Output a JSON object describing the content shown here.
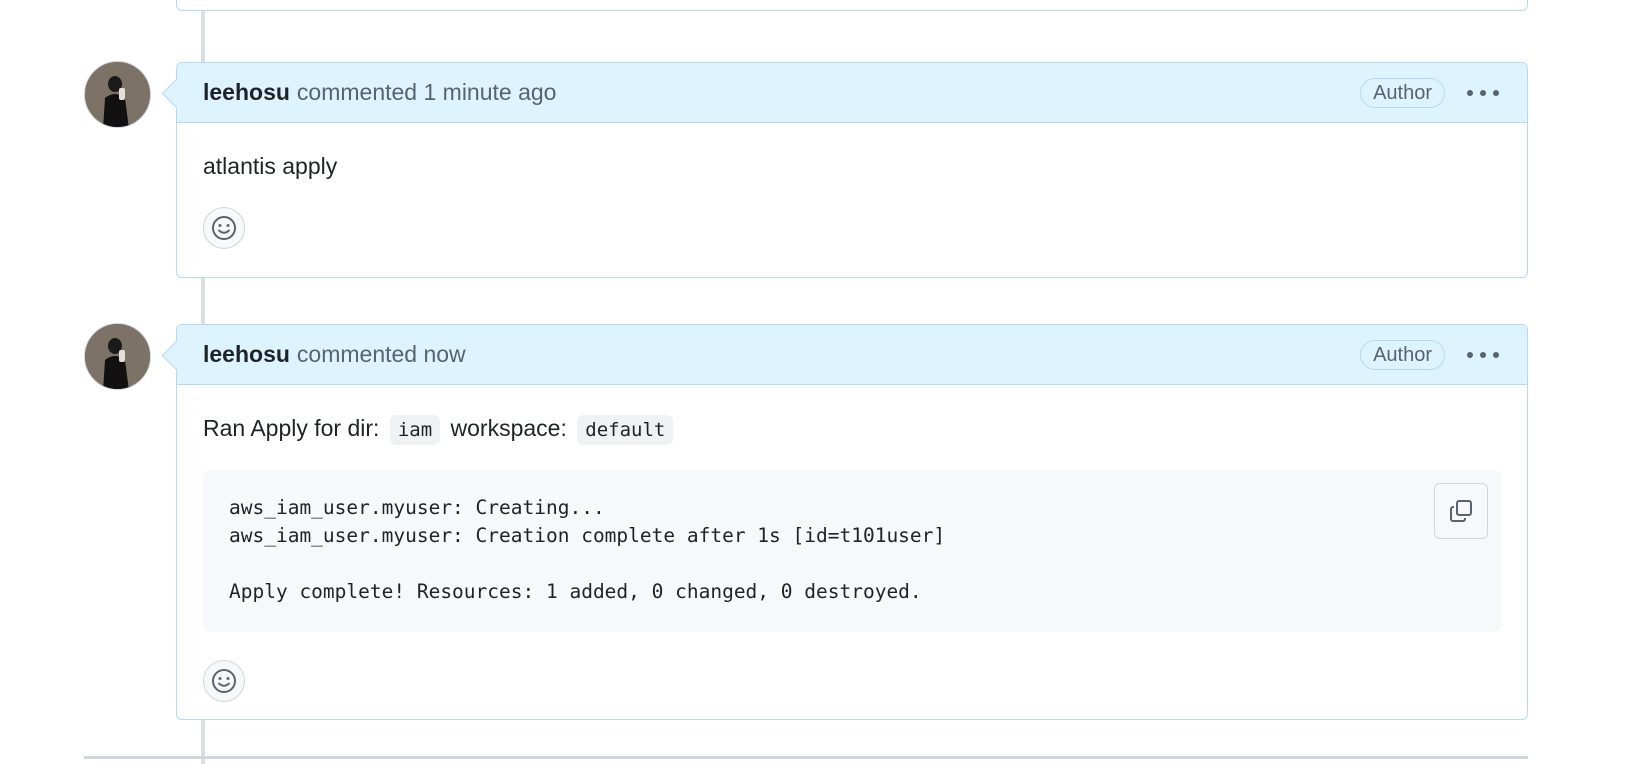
{
  "comments": [
    {
      "author": "leehosu",
      "meta": "commented 1 minute ago",
      "badge": "Author",
      "body": "atlantis apply"
    },
    {
      "author": "leehosu",
      "meta": "commented now",
      "badge": "Author",
      "body_prefix": "Ran Apply for dir:",
      "dir_code": "iam",
      "body_middle": "workspace:",
      "workspace_code": "default",
      "code_lines": [
        "aws_iam_user.myuser: Creating...",
        "aws_iam_user.myuser: Creation complete after 1s [id=t101user]",
        "",
        "Apply complete! Resources: 1 added, 0 changed, 0 destroyed."
      ]
    }
  ],
  "icons": {
    "avatar": "avatar",
    "more": "kebab-horizontal-icon",
    "reaction": "smiley-icon",
    "copy": "copy-icon"
  },
  "colors": {
    "header_bg": "#ddf4ff",
    "border": "#b6d7f5",
    "muted_text": "#59636e"
  }
}
